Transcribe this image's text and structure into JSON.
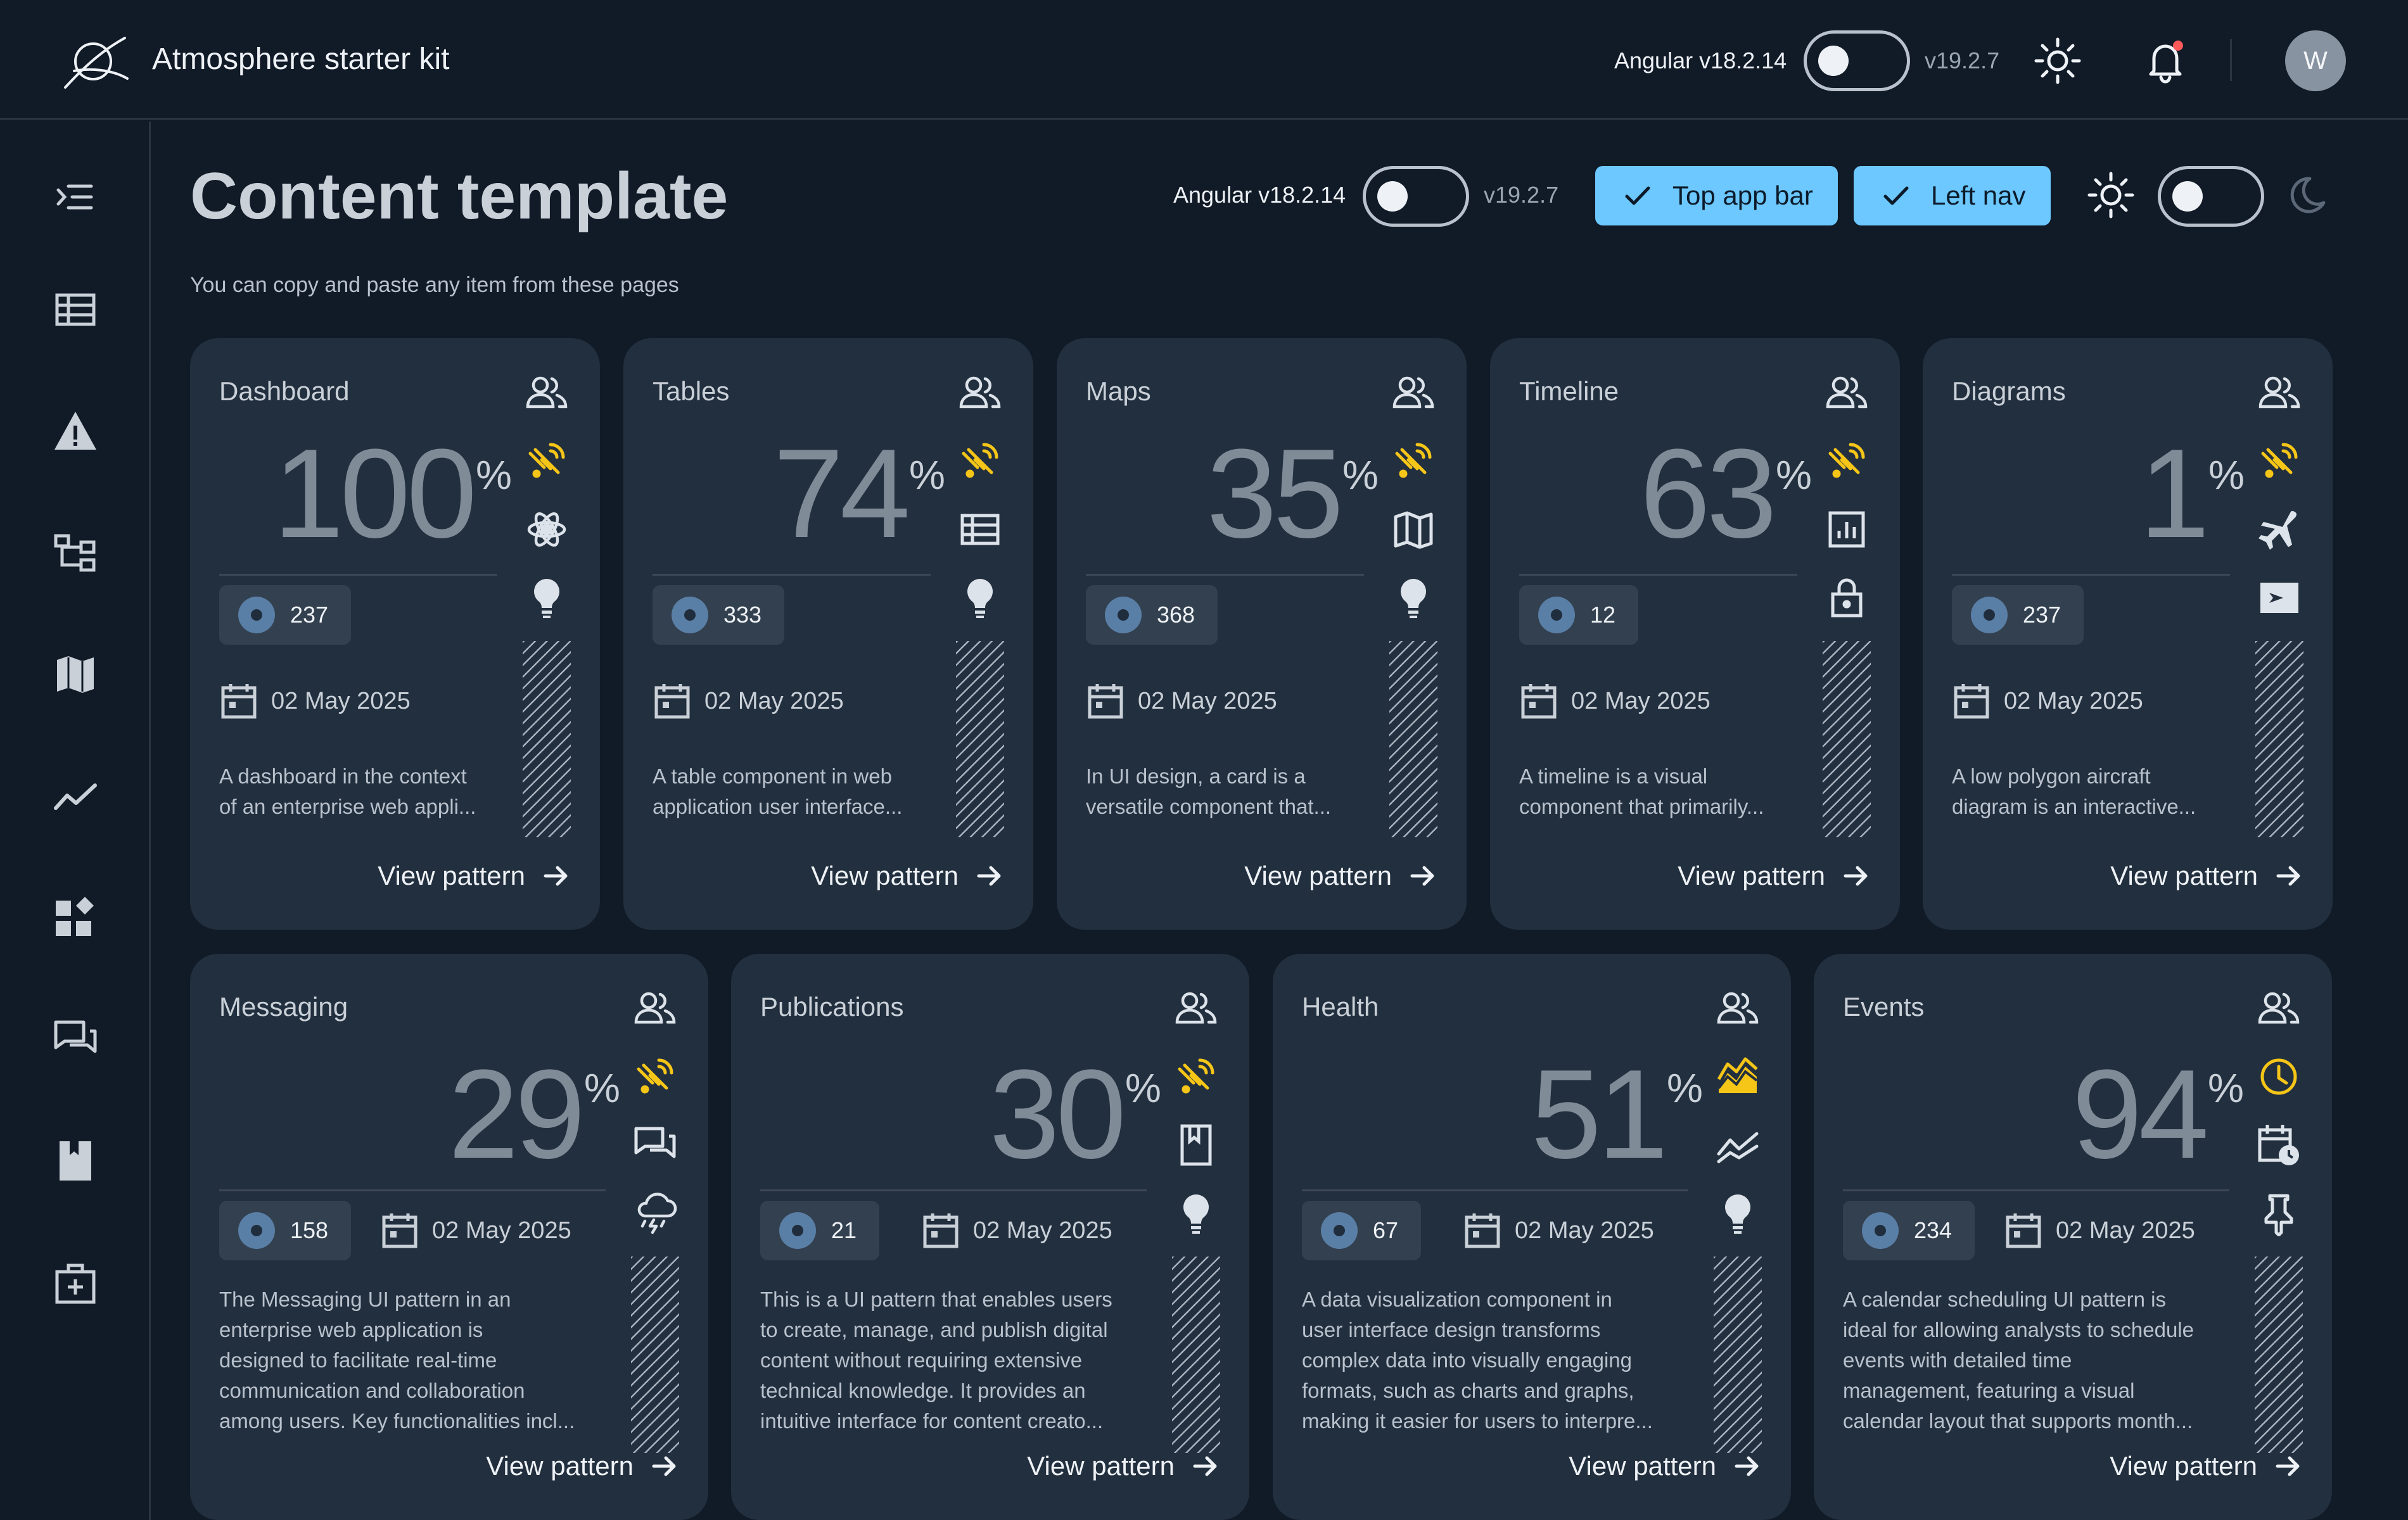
{
  "app": {
    "title": "Atmosphere starter kit",
    "version_from": "Angular v18.2.14",
    "version_to": "v19.2.7",
    "user_initial": "W"
  },
  "header": {
    "title": "Content template",
    "subtitle": "You can copy and paste any item from these pages",
    "version_from": "Angular v18.2.14",
    "version_to": "v19.2.7",
    "top_app_bar_label": "Top app bar",
    "left_nav_label": "Left nav"
  },
  "nav": [
    "menu-open-icon",
    "table-icon",
    "warning-icon",
    "hierarchy-icon",
    "map-icon",
    "trend-icon",
    "widgets-icon",
    "forum-icon",
    "bookmark-icon",
    "medical-kit-icon"
  ],
  "colors": {
    "accent": "#6cc8ff",
    "warning": "#f5c518",
    "card": "#222f3e",
    "background": "#111a27"
  },
  "cards": [
    {
      "title": "Dashboard",
      "percent": "100",
      "count": "237",
      "date": "02 May 2025",
      "desc": [
        "A dashboard in the context",
        "of an enterprise web appli..."
      ],
      "icons": [
        "group-icon",
        "satellite-icon",
        "atom-icon",
        "lightbulb-icon"
      ],
      "link": "View pattern"
    },
    {
      "title": "Tables",
      "percent": "74",
      "count": "333",
      "date": "02 May 2025",
      "desc": [
        "A table component in web",
        "application user interface..."
      ],
      "icons": [
        "group-icon",
        "satellite-icon",
        "table-icon",
        "lightbulb-icon"
      ],
      "link": "View pattern"
    },
    {
      "title": "Maps",
      "percent": "35",
      "count": "368",
      "date": "02 May 2025",
      "desc": [
        "In UI design, a card is a",
        "versatile component that..."
      ],
      "icons": [
        "group-icon",
        "satellite-icon",
        "map-icon",
        "lightbulb-icon"
      ],
      "link": "View pattern"
    },
    {
      "title": "Timeline",
      "percent": "63",
      "count": "12",
      "date": "02 May 2025",
      "desc": [
        "A timeline is a visual",
        "component that primarily..."
      ],
      "icons": [
        "group-icon",
        "satellite-icon",
        "chart-icon",
        "lock-icon"
      ],
      "link": "View pattern"
    },
    {
      "title": "Diagrams",
      "percent": "1",
      "count": "237",
      "date": "02 May 2025",
      "desc": [
        "A low polygon aircraft",
        "diagram is an interactive..."
      ],
      "icons": [
        "group-icon",
        "satellite-icon",
        "airplane-icon",
        "flight-card-icon"
      ],
      "link": "View pattern"
    },
    {
      "title": "Messaging",
      "percent": "29",
      "count": "158",
      "date": "02 May 2025",
      "desc": [
        "The Messaging UI pattern in an",
        "enterprise web application is",
        "designed to facilitate real-time",
        "communication and collaboration",
        "among users. Key functionalities incl..."
      ],
      "icons": [
        "group-icon",
        "satellite-icon",
        "forum-icon",
        "storm-icon"
      ],
      "link": "View pattern"
    },
    {
      "title": "Publications",
      "percent": "30",
      "count": "21",
      "date": "02 May 2025",
      "desc": [
        "This is a UI pattern that enables users",
        "to create, manage, and publish digital",
        "content without requiring extensive",
        "technical knowledge. It provides an",
        "intuitive interface for content creato..."
      ],
      "icons": [
        "group-icon",
        "satellite-icon",
        "book-icon",
        "lightbulb-icon"
      ],
      "link": "View pattern"
    },
    {
      "title": "Health",
      "percent": "51",
      "count": "67",
      "date": "02 May 2025",
      "desc": [
        "A data visualization component in",
        "user interface design transforms",
        "complex data into visually engaging",
        "formats, such as charts and graphs,",
        "making it easier for users to interpre..."
      ],
      "icons": [
        "group-icon",
        "area-chart-icon",
        "trend-icon",
        "lightbulb-icon"
      ],
      "link": "View pattern"
    },
    {
      "title": "Events",
      "percent": "94",
      "count": "234",
      "date": "02 May 2025",
      "desc": [
        "A calendar scheduling UI pattern is",
        "ideal for allowing analysts to schedule",
        "events with detailed time",
        "management, featuring a visual",
        "calendar layout that supports month..."
      ],
      "icons": [
        "group-icon",
        "clock-icon",
        "calendar-clock-icon",
        "pin-icon"
      ],
      "link": "View pattern"
    }
  ]
}
